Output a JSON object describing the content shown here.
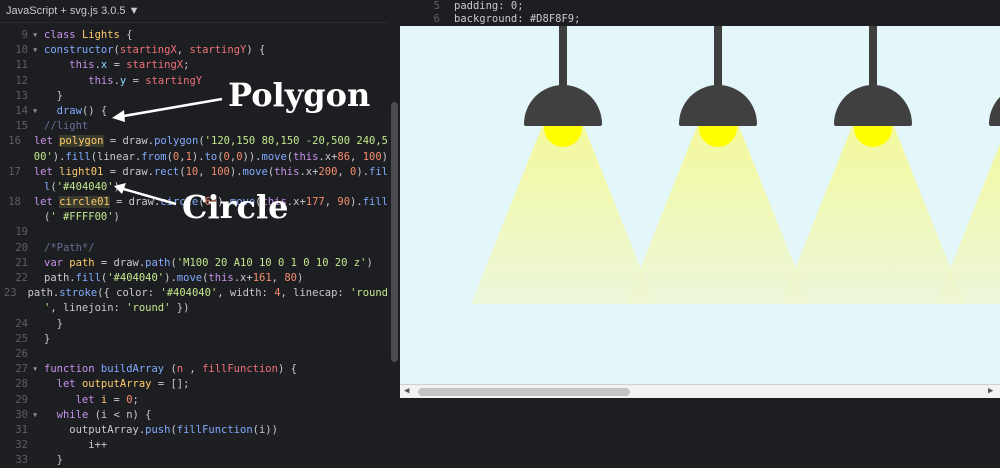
{
  "topbar": {
    "title": "JavaScript + svg.js 3.0.5 ▼"
  },
  "annotations": {
    "polygon": "Polygon",
    "circle": "Circle"
  },
  "css_peek": [
    {
      "n": "5",
      "text": "padding: 0;"
    },
    {
      "n": "6",
      "text": "background: #D8F8F9;"
    }
  ],
  "code_lines": [
    {
      "n": "9",
      "fold": "▾",
      "html": "<span class='kw'>class</span> <span class='cls'>Lights</span> {"
    },
    {
      "n": "10",
      "fold": "▾",
      "html": "<span class='fn'>constructor</span>(<span class='var'>startingX</span>, <span class='var'>startingY</span>) {"
    },
    {
      "n": "11",
      "fold": "",
      "html": "    <span class='kw'>this</span>.<span class='prop'>x</span> = <span class='var'>startingX</span>;"
    },
    {
      "n": "12",
      "fold": "",
      "html": "       <span class='kw'>this</span>.<span class='prop'>y</span> = <span class='var'>startingY</span>"
    },
    {
      "n": "13",
      "fold": "",
      "html": "  }"
    },
    {
      "n": "14",
      "fold": "▾",
      "html": "  <span class='fn'>draw</span>() {"
    },
    {
      "n": "15",
      "fold": "",
      "html": "<span class='cm'>//light</span>"
    },
    {
      "n": "16",
      "fold": "",
      "html": "<span class='kw'>let</span> <span class='hl'><span class='cls'>polygon</span></span> = draw.<span class='fn'>polygon</span>(<span class='str'>'120,150 80,150 -20,500 240,5</span>"
    },
    {
      "n": "",
      "fold": "",
      "html": "<span class='str'>00'</span>).<span class='fn'>fill</span>(linear.<span class='fn'>from</span>(<span class='num'>0</span>,<span class='num'>1</span>).<span class='fn'>to</span>(<span class='num'>0</span>,<span class='num'>0</span>)).<span class='fn'>move</span>(<span class='kw'>this</span>.x+<span class='num'>86</span>, <span class='num'>100</span>)"
    },
    {
      "n": "17",
      "fold": "",
      "html": "<span class='kw'>let</span> <span class='cls'>light01</span> = draw.<span class='fn'>rect</span>(<span class='num'>10</span>, <span class='num'>100</span>).<span class='fn'>move</span>(<span class='kw'>this</span>.x+<span class='num'>200</span>, <span class='num'>0</span>).<span class='fn'>fil</span>"
    },
    {
      "n": "",
      "fold": "",
      "html": "<span class='fn'>l</span>(<span class='str'>'#404040'</span>)"
    },
    {
      "n": "18",
      "fold": "",
      "html": "<span class='kw'>let</span> <span class='hl'><span class='cls'>circle01</span></span> = draw.<span class='fn'>circle</span>(<span class='num'>60</span>).<span class='fn'>move</span>(<span class='kw'>this</span>.x+<span class='num'>177</span>, <span class='num'>90</span>).<span class='fn'>fill</span>"
    },
    {
      "n": "",
      "fold": "",
      "html": "(<span class='str'>' #FFFF00'</span>)"
    },
    {
      "n": "19",
      "fold": "",
      "html": ""
    },
    {
      "n": "20",
      "fold": "",
      "html": "<span class='cm'>/*Path*/</span>"
    },
    {
      "n": "21",
      "fold": "",
      "html": "<span class='kw'>var</span> <span class='cls'>path</span> = draw.<span class='fn'>path</span>(<span class='str'>'M100 20 A10 10 0 1 0 10 20 z'</span>)"
    },
    {
      "n": "22",
      "fold": "",
      "html": "path.<span class='fn'>fill</span>(<span class='str'>'#404040'</span>).<span class='fn'>move</span>(<span class='kw'>this</span>.x+<span class='num'>161</span>, <span class='num'>80</span>)"
    },
    {
      "n": "23",
      "fold": "",
      "html": "path.<span class='fn'>stroke</span>({ color: <span class='str'>'#404040'</span>, width: <span class='num'>4</span>, linecap: <span class='str'>'round</span>"
    },
    {
      "n": "",
      "fold": "",
      "html": "<span class='str'>'</span>, linejoin: <span class='str'>'round'</span> })"
    },
    {
      "n": "24",
      "fold": "",
      "html": "  }"
    },
    {
      "n": "25",
      "fold": "",
      "html": "}"
    },
    {
      "n": "26",
      "fold": "",
      "html": ""
    },
    {
      "n": "27",
      "fold": "▾",
      "html": "<span class='kw'>function</span> <span class='fn'>buildArray</span> (<span class='var'>n</span> , <span class='var'>fillFunction</span>) {"
    },
    {
      "n": "28",
      "fold": "",
      "html": "  <span class='kw'>let</span> <span class='cls'>outputArray</span> = [];"
    },
    {
      "n": "29",
      "fold": "",
      "html": "     <span class='kw'>let</span> <span class='cls'>i</span> = <span class='num'>0</span>;"
    },
    {
      "n": "30",
      "fold": "▾",
      "html": "  <span class='kw'>while</span> (i &lt; n) {"
    },
    {
      "n": "31",
      "fold": "",
      "html": "    outputArray.<span class='fn'>push</span>(<span class='fn'>fillFunction</span>(i))"
    },
    {
      "n": "32",
      "fold": "",
      "html": "       i++"
    },
    {
      "n": "33",
      "fold": "",
      "html": "  }"
    }
  ],
  "scroll_arrows": {
    "left": "◀",
    "right": "▶"
  }
}
